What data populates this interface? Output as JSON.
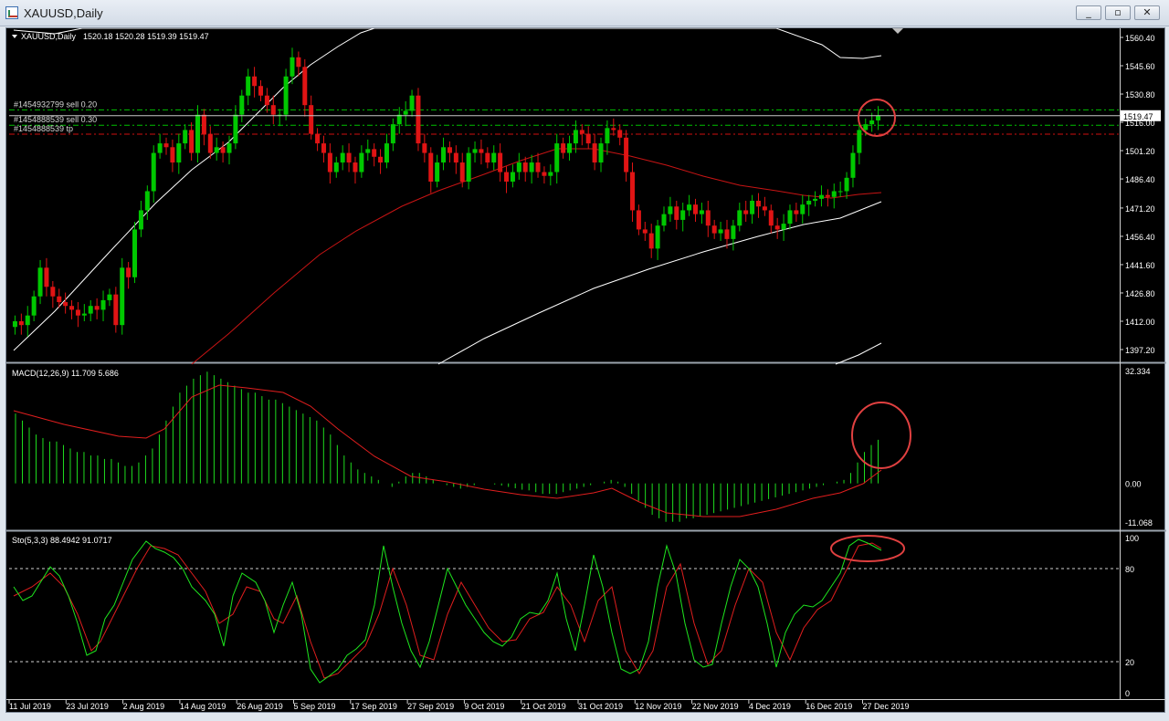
{
  "window": {
    "title": "XAUUSD,Daily",
    "buttons": [
      "_",
      "▫",
      "✕"
    ]
  },
  "colors": {
    "background": "#000000",
    "bull": "#00c800",
    "bear": "#e01414",
    "ma_slow": "#c81414",
    "band": "#ffffff",
    "macd_hist": "#1edc1e",
    "macd_signal": "#e01e1e",
    "stoch_main": "#1ee61e",
    "stoch_signal": "#e01e1e",
    "circles": "#e04040",
    "level_sell": "#00c000",
    "level_tp": "#d01010",
    "current_price": "#c8c8c8",
    "axis_text": "#ffffff"
  },
  "chart_data": [
    {
      "type": "candlestick",
      "title": "XAUUSD,Daily",
      "ohlc_header": "1520.18 1520.28 1519.39 1519.47",
      "dates_axis": [
        "11 Jul 2019",
        "23 Jul 2019",
        "2 Aug 2019",
        "14 Aug 2019",
        "26 Aug 2019",
        "5 Sep 2019",
        "17 Sep 2019",
        "27 Sep 2019",
        "9 Oct 2019",
        "21 Oct 2019",
        "31 Oct 2019",
        "12 Nov 2019",
        "22 Nov 2019",
        "4 Dec 2019",
        "16 Dec 2019",
        "27 Dec 2019"
      ],
      "price_ticks": [
        1560.4,
        1545.6,
        1530.8,
        1516.0,
        1501.2,
        1486.4,
        1471.2,
        1456.4,
        1441.6,
        1426.8,
        1412.0,
        1397.2
      ],
      "ylim": [
        1397.2,
        1560.4
      ],
      "current_price": "1519.47",
      "order_levels": [
        {
          "label": "#1454932799 sell 0.20",
          "price": 1522.5,
          "kind": "sell"
        },
        {
          "label": "#1454888539 sell 0.30",
          "price": 1514.5,
          "kind": "sell"
        },
        {
          "label": "#1454888539 tp",
          "price": 1509.8,
          "kind": "tp"
        }
      ],
      "closes": [
        1412,
        1410,
        1415,
        1425,
        1440,
        1430,
        1425,
        1422,
        1420,
        1418,
        1415,
        1416,
        1420,
        1418,
        1423,
        1426,
        1410,
        1440,
        1435,
        1460,
        1470,
        1480,
        1500,
        1505,
        1503,
        1495,
        1505,
        1512,
        1500,
        1520,
        1510,
        1500,
        1503,
        1500,
        1505,
        1520,
        1530,
        1540,
        1535,
        1530,
        1525,
        1520,
        1520,
        1540,
        1550,
        1545,
        1525,
        1510,
        1505,
        1500,
        1490,
        1495,
        1500,
        1495,
        1490,
        1500,
        1502,
        1498,
        1495,
        1505,
        1515,
        1520,
        1522,
        1530,
        1505,
        1500,
        1485,
        1495,
        1503,
        1500,
        1495,
        1485,
        1500,
        1502,
        1500,
        1495,
        1500,
        1490,
        1485,
        1490,
        1495,
        1490,
        1495,
        1490,
        1488,
        1490,
        1505,
        1500,
        1505,
        1512,
        1510,
        1505,
        1495,
        1505,
        1513,
        1512,
        1508,
        1490,
        1470,
        1460,
        1458,
        1450,
        1462,
        1468,
        1472,
        1465,
        1470,
        1473,
        1468,
        1470,
        1462,
        1458,
        1460,
        1455,
        1462,
        1470,
        1468,
        1475,
        1472,
        1470,
        1462,
        1460,
        1463,
        1470,
        1468,
        1473,
        1475,
        1476,
        1478,
        1477,
        1480,
        1480,
        1487,
        1500,
        1512,
        1515,
        1517,
        1519.5
      ],
      "bands": {
        "upper": [
          [
            5,
            2
          ],
          [
            50,
            6
          ],
          [
            80,
            0
          ],
          [
            200,
            0
          ],
          [
            360,
            0
          ],
          [
            400,
            0
          ],
          [
            415,
            0
          ],
          [
            840,
            0
          ],
          [
            890,
            18
          ],
          [
            910,
            32
          ],
          [
            935,
            33
          ],
          [
            955,
            30
          ]
        ],
        "middle": [
          [
            5,
            353
          ],
          [
            50,
            310
          ],
          [
            110,
            245
          ],
          [
            160,
            192
          ],
          [
            200,
            155
          ],
          [
            240,
            125
          ],
          [
            270,
            95
          ],
          [
            300,
            65
          ],
          [
            330,
            40
          ],
          [
            360,
            20
          ],
          [
            385,
            5
          ],
          [
            400,
            0
          ]
        ],
        "lower": [
          [
            470,
            368
          ],
          [
            520,
            340
          ],
          [
            580,
            312
          ],
          [
            640,
            285
          ],
          [
            700,
            264
          ],
          [
            760,
            245
          ],
          [
            820,
            228
          ],
          [
            870,
            215
          ],
          [
            910,
            208
          ],
          [
            955,
            190
          ]
        ],
        "upper_lower_right": [
          [
            905,
            368
          ],
          [
            930,
            358
          ],
          [
            955,
            345
          ]
        ]
      },
      "ma_slow_path": [
        [
          200,
          368
        ],
        [
          240,
          335
        ],
        [
          290,
          290
        ],
        [
          340,
          248
        ],
        [
          380,
          222
        ],
        [
          430,
          195
        ],
        [
          470,
          178
        ],
        [
          520,
          160
        ],
        [
          560,
          145
        ],
        [
          600,
          132
        ],
        [
          640,
          132
        ],
        [
          680,
          140
        ],
        [
          720,
          150
        ],
        [
          760,
          162
        ],
        [
          800,
          172
        ],
        [
          840,
          178
        ],
        [
          870,
          183
        ],
        [
          900,
          186
        ],
        [
          930,
          182
        ],
        [
          955,
          180
        ]
      ]
    },
    {
      "type": "bar",
      "title": "MACD(12,26,9) 11.709 5.686",
      "ticks": [
        "32.334",
        "0.00",
        "-11.068"
      ],
      "ylim": [
        -11.068,
        32.334
      ],
      "hist": [
        20,
        18,
        16,
        14,
        13,
        12,
        12,
        11,
        10,
        9,
        9,
        8,
        8,
        7,
        7,
        6,
        5,
        5,
        6,
        8,
        10,
        14,
        18,
        22,
        26,
        28,
        30,
        31,
        32,
        31,
        30,
        29,
        28,
        27,
        26,
        26,
        25,
        24,
        24,
        23,
        22,
        21,
        20,
        19,
        18,
        16,
        14,
        11,
        8,
        6,
        4,
        3,
        2,
        1,
        0,
        -1,
        0.5,
        2,
        3,
        3,
        2,
        1,
        0,
        -0.5,
        -1,
        -1.5,
        -1,
        -0.5,
        0,
        0,
        -0.3,
        -0.6,
        -1,
        -1.4,
        -1.8,
        -2,
        -2.5,
        -3,
        -3,
        -3,
        -2.5,
        -2,
        -1.5,
        -1,
        -0.5,
        0,
        0.5,
        1,
        0.5,
        -1,
        -3,
        -5,
        -7,
        -9,
        -10,
        -11,
        -11,
        -11,
        -10,
        -10,
        -9.5,
        -9,
        -8.5,
        -8,
        -7.5,
        -7,
        -6.5,
        -6,
        -5.5,
        -5,
        -4.5,
        -4,
        -3.5,
        -3,
        -2.5,
        -2,
        -1.5,
        -1,
        -0.5,
        0,
        0.5,
        1,
        3,
        6,
        9,
        11,
        12.5
      ],
      "signal_path": [
        [
          5,
          50
        ],
        [
          60,
          65
        ],
        [
          120,
          78
        ],
        [
          150,
          80
        ],
        [
          170,
          70
        ],
        [
          200,
          35
        ],
        [
          230,
          22
        ],
        [
          260,
          25
        ],
        [
          300,
          30
        ],
        [
          330,
          45
        ],
        [
          360,
          70
        ],
        [
          400,
          100
        ],
        [
          440,
          122
        ],
        [
          480,
          128
        ],
        [
          520,
          136
        ],
        [
          560,
          142
        ],
        [
          600,
          146
        ],
        [
          640,
          140
        ],
        [
          660,
          135
        ],
        [
          690,
          150
        ],
        [
          720,
          162
        ],
        [
          760,
          166
        ],
        [
          800,
          166
        ],
        [
          840,
          158
        ],
        [
          880,
          146
        ],
        [
          910,
          140
        ],
        [
          935,
          130
        ],
        [
          955,
          115
        ]
      ],
      "signal_last": 5.686
    },
    {
      "type": "line",
      "title": "Sto(5,3,3) 88.4942 91.0717",
      "ticks": [
        "100",
        "80",
        "20",
        "0"
      ],
      "ylim": [
        0,
        100
      ],
      "levels": [
        80,
        20
      ],
      "main_path": [
        [
          5,
          60
        ],
        [
          15,
          75
        ],
        [
          25,
          70
        ],
        [
          45,
          38
        ],
        [
          55,
          48
        ],
        [
          65,
          70
        ],
        [
          75,
          100
        ],
        [
          85,
          135
        ],
        [
          95,
          130
        ],
        [
          105,
          95
        ],
        [
          115,
          80
        ],
        [
          125,
          55
        ],
        [
          135,
          30
        ],
        [
          150,
          10
        ],
        [
          160,
          18
        ],
        [
          170,
          22
        ],
        [
          180,
          28
        ],
        [
          190,
          40
        ],
        [
          200,
          60
        ],
        [
          215,
          75
        ],
        [
          225,
          90
        ],
        [
          235,
          125
        ],
        [
          245,
          70
        ],
        [
          255,
          45
        ],
        [
          270,
          55
        ],
        [
          280,
          75
        ],
        [
          290,
          110
        ],
        [
          300,
          80
        ],
        [
          310,
          55
        ],
        [
          320,
          90
        ],
        [
          330,
          150
        ],
        [
          340,
          165
        ],
        [
          350,
          158
        ],
        [
          360,
          150
        ],
        [
          370,
          135
        ],
        [
          380,
          128
        ],
        [
          390,
          118
        ],
        [
          400,
          80
        ],
        [
          410,
          15
        ],
        [
          420,
          60
        ],
        [
          430,
          100
        ],
        [
          440,
          130
        ],
        [
          450,
          148
        ],
        [
          460,
          120
        ],
        [
          470,
          80
        ],
        [
          480,
          40
        ],
        [
          490,
          60
        ],
        [
          500,
          80
        ],
        [
          510,
          95
        ],
        [
          520,
          110
        ],
        [
          530,
          120
        ],
        [
          540,
          125
        ],
        [
          550,
          115
        ],
        [
          560,
          95
        ],
        [
          570,
          88
        ],
        [
          580,
          90
        ],
        [
          590,
          75
        ],
        [
          600,
          45
        ],
        [
          610,
          95
        ],
        [
          620,
          130
        ],
        [
          630,
          80
        ],
        [
          640,
          25
        ],
        [
          650,
          60
        ],
        [
          660,
          110
        ],
        [
          670,
          150
        ],
        [
          680,
          155
        ],
        [
          690,
          150
        ],
        [
          700,
          120
        ],
        [
          710,
          60
        ],
        [
          720,
          15
        ],
        [
          730,
          45
        ],
        [
          740,
          100
        ],
        [
          750,
          140
        ],
        [
          760,
          148
        ],
        [
          770,
          145
        ],
        [
          780,
          100
        ],
        [
          790,
          60
        ],
        [
          800,
          30
        ],
        [
          810,
          40
        ],
        [
          820,
          60
        ],
        [
          830,
          100
        ],
        [
          840,
          148
        ],
        [
          850,
          110
        ],
        [
          860,
          90
        ],
        [
          870,
          80
        ],
        [
          880,
          82
        ],
        [
          890,
          75
        ],
        [
          900,
          60
        ],
        [
          910,
          45
        ],
        [
          920,
          15
        ],
        [
          930,
          8
        ],
        [
          940,
          12
        ],
        [
          955,
          20
        ]
      ],
      "signal_path": [
        [
          5,
          70
        ],
        [
          25,
          60
        ],
        [
          45,
          45
        ],
        [
          60,
          60
        ],
        [
          75,
          90
        ],
        [
          90,
          130
        ],
        [
          100,
          120
        ],
        [
          110,
          100
        ],
        [
          125,
          70
        ],
        [
          140,
          40
        ],
        [
          155,
          15
        ],
        [
          170,
          18
        ],
        [
          185,
          25
        ],
        [
          200,
          45
        ],
        [
          215,
          65
        ],
        [
          230,
          100
        ],
        [
          245,
          90
        ],
        [
          260,
          60
        ],
        [
          275,
          65
        ],
        [
          290,
          95
        ],
        [
          300,
          100
        ],
        [
          315,
          70
        ],
        [
          330,
          120
        ],
        [
          345,
          160
        ],
        [
          360,
          155
        ],
        [
          375,
          140
        ],
        [
          390,
          125
        ],
        [
          405,
          90
        ],
        [
          420,
          40
        ],
        [
          435,
          80
        ],
        [
          450,
          135
        ],
        [
          465,
          140
        ],
        [
          480,
          90
        ],
        [
          495,
          55
        ],
        [
          510,
          80
        ],
        [
          525,
          105
        ],
        [
          540,
          120
        ],
        [
          555,
          118
        ],
        [
          570,
          95
        ],
        [
          585,
          88
        ],
        [
          600,
          60
        ],
        [
          615,
          80
        ],
        [
          630,
          120
        ],
        [
          645,
          75
        ],
        [
          660,
          60
        ],
        [
          675,
          130
        ],
        [
          690,
          155
        ],
        [
          705,
          130
        ],
        [
          720,
          60
        ],
        [
          735,
          35
        ],
        [
          750,
          100
        ],
        [
          765,
          145
        ],
        [
          780,
          130
        ],
        [
          795,
          80
        ],
        [
          810,
          40
        ],
        [
          825,
          55
        ],
        [
          840,
          110
        ],
        [
          855,
          140
        ],
        [
          870,
          105
        ],
        [
          885,
          85
        ],
        [
          900,
          75
        ],
        [
          915,
          45
        ],
        [
          930,
          15
        ],
        [
          945,
          12
        ],
        [
          955,
          18
        ]
      ]
    }
  ],
  "annotations": [
    {
      "panel": 0,
      "cx": 950,
      "cy": 98,
      "rx": 20,
      "ry": 20
    },
    {
      "panel": 1,
      "cx": 955,
      "cy": 77,
      "rx": 32,
      "ry": 36
    },
    {
      "panel": 2,
      "cx": 940,
      "cy": 18,
      "rx": 40,
      "ry": 14
    }
  ]
}
